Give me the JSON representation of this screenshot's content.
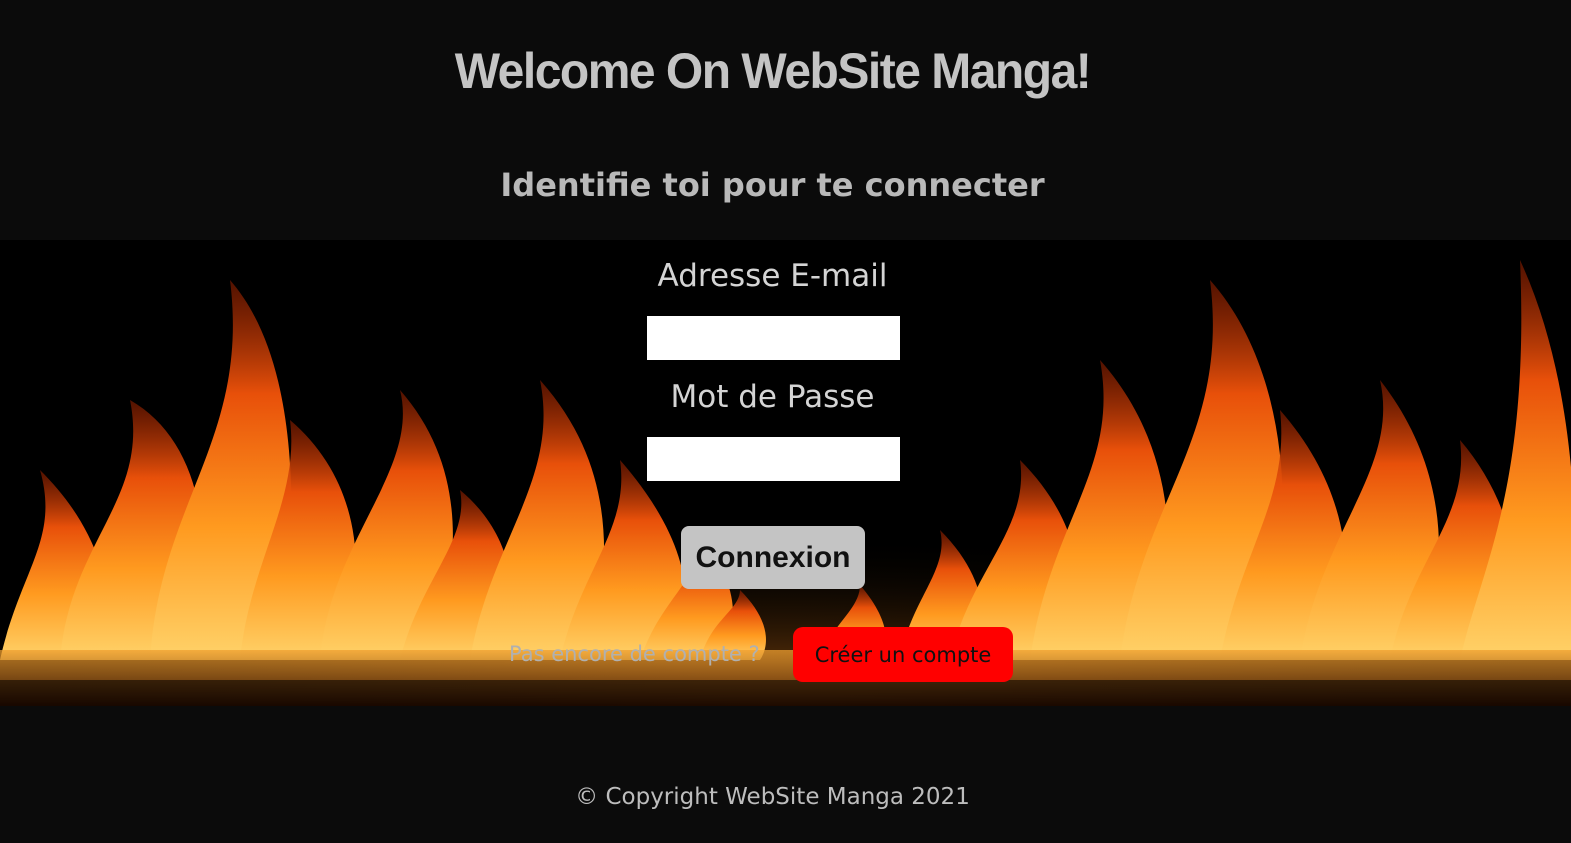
{
  "header": {
    "title": "Welcome On WebSite Manga!",
    "subtitle": "Identifie toi pour te connecter"
  },
  "login_form": {
    "email_label": "Adresse E-mail",
    "email_value": "",
    "password_label": "Mot de Passe",
    "password_value": "",
    "submit_label": "Connexion"
  },
  "signup": {
    "prompt": "Pas encore de compte ?",
    "button_label": "Créer un compte"
  },
  "footer": {
    "copyright": "© Copyright WebSite Manga 2021"
  },
  "colors": {
    "background": "#0b0b0b",
    "title_text": "#c4c4c4",
    "login_button": "#c4c4c4",
    "signup_button": "#ff0000"
  },
  "background_image": "flames-over-black-reflective-floor"
}
